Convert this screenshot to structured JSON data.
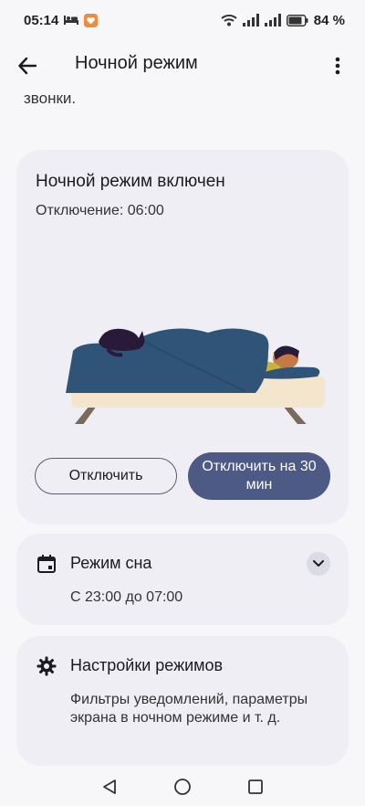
{
  "status_bar": {
    "time": "05:14",
    "battery_percent": "84 %",
    "icons": [
      "bed-icon",
      "heart-app-icon",
      "wifi-icon",
      "signal-icon",
      "signal-icon",
      "battery-icon"
    ]
  },
  "app_bar": {
    "title": "Ночной режим",
    "back_icon": "arrow-left-icon",
    "more_icon": "more-vertical-icon"
  },
  "partial_text": "звонки.",
  "main_card": {
    "title": "Ночной режим включен",
    "subtitle": "Отключение: 06:00",
    "illustration": "person-sleeping-with-cat",
    "buttons": {
      "disable_label": "Отключить",
      "snooze_label": "Отключить на 30 мин"
    }
  },
  "sleep_card": {
    "icon": "calendar-icon",
    "title": "Режим сна",
    "schedule": "С 23:00 до 07:00"
  },
  "modes_card": {
    "icon": "gear-icon",
    "title": "Настройки режимов",
    "description": "Фильтры уведомлений, параметры экрана в ночном режиме и т. д."
  },
  "colors": {
    "accent": "#4e5a86",
    "card_bg": "#eeeef4",
    "page_bg": "#f7f7fa",
    "blanket": "#2f5477",
    "bed": "#f3e6cc"
  }
}
